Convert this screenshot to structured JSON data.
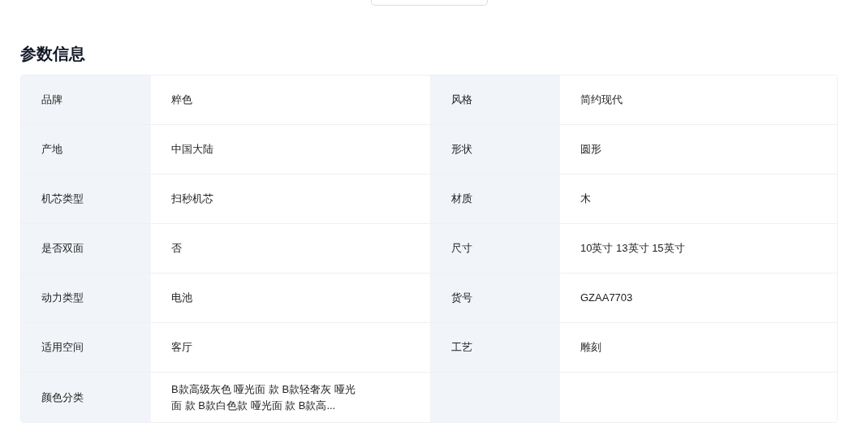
{
  "title": "参数信息",
  "specs": [
    {
      "label": "品牌",
      "value": "粹色"
    },
    {
      "label": "风格",
      "value": "简约现代"
    },
    {
      "label": "产地",
      "value": "中国大陆"
    },
    {
      "label": "形状",
      "value": "圆形"
    },
    {
      "label": "机芯类型",
      "value": "扫秒机芯"
    },
    {
      "label": "材质",
      "value": "木"
    },
    {
      "label": "是否双面",
      "value": "否"
    },
    {
      "label": "尺寸",
      "value": "10英寸 13英寸 15英寸"
    },
    {
      "label": "动力类型",
      "value": "电池"
    },
    {
      "label": "货号",
      "value": "GZAA7703"
    },
    {
      "label": "适用空间",
      "value": "客厅"
    },
    {
      "label": "工艺",
      "value": "雕刻"
    },
    {
      "label": "颜色分类",
      "value": "B款高级灰色 哑光面 款 B款轻奢灰 哑光面 款 B款白色款 哑光面 款 B款高..."
    }
  ]
}
